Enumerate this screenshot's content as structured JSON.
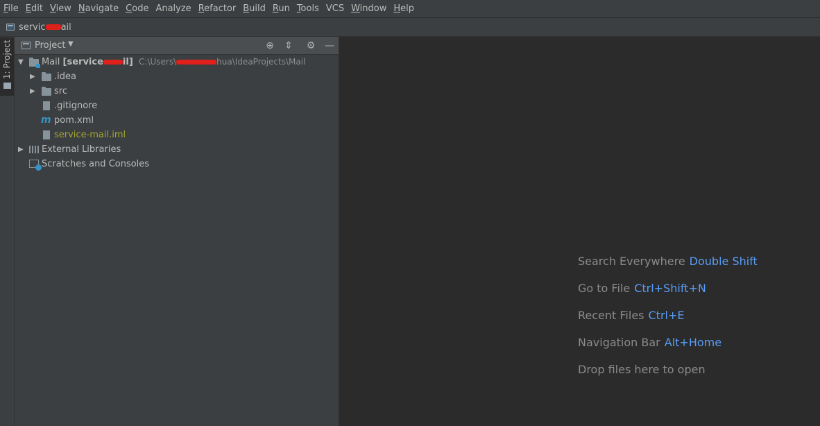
{
  "menu": {
    "items": [
      {
        "mnemonic": "F",
        "rest": "ile"
      },
      {
        "mnemonic": "E",
        "rest": "dit"
      },
      {
        "mnemonic": "V",
        "rest": "iew"
      },
      {
        "mnemonic": "N",
        "rest": "avigate"
      },
      {
        "mnemonic": "C",
        "rest": "ode"
      },
      {
        "mnemonic": "",
        "rest": "Analyze"
      },
      {
        "mnemonic": "R",
        "rest": "efactor"
      },
      {
        "mnemonic": "B",
        "rest": "uild"
      },
      {
        "mnemonic": "R",
        "rest": "un"
      },
      {
        "mnemonic": "T",
        "rest": "ools"
      },
      {
        "mnemonic": "",
        "rest": "VCS"
      },
      {
        "mnemonic": "W",
        "rest": "indow"
      },
      {
        "mnemonic": "H",
        "rest": "elp"
      }
    ]
  },
  "navbar": {
    "module_prefix": "servic",
    "module_suffix": "ail",
    "module_icon": "module-icon"
  },
  "side_strip": {
    "tab_label": "1: Project",
    "tab_icon": "folder-icon"
  },
  "project_panel": {
    "title": "Project",
    "dropdown_icon": "chevron-down-icon",
    "header_icons": [
      "locate-icon",
      "collapse-all-icon",
      "gear-icon",
      "minimize-icon"
    ],
    "tree": {
      "root": {
        "name": "Mail",
        "module_prefix": "[service",
        "module_suffix": "il]",
        "path_prefix": "C:\\Users\\",
        "path_suffix": "hua\\IdeaProjects\\Mail"
      },
      "children": [
        {
          "name": ".idea",
          "kind": "folder",
          "expandable": true
        },
        {
          "name": "src",
          "kind": "folder",
          "expandable": true
        },
        {
          "name": ".gitignore",
          "kind": "file",
          "expandable": false
        },
        {
          "name": "pom.xml",
          "kind": "maven",
          "expandable": false
        },
        {
          "name": "service-mail.iml",
          "kind": "iml",
          "expandable": false
        }
      ],
      "external_libraries": "External Libraries",
      "scratches": "Scratches and Consoles"
    }
  },
  "editor_hints": [
    {
      "label": "Search Everywhere",
      "shortcut": "Double Shift"
    },
    {
      "label": "Go to File",
      "shortcut": "Ctrl+Shift+N"
    },
    {
      "label": "Recent Files",
      "shortcut": "Ctrl+E"
    },
    {
      "label": "Navigation Bar",
      "shortcut": "Alt+Home"
    },
    {
      "label": "Drop files here to open",
      "shortcut": ""
    }
  ],
  "colors": {
    "background": "#2b2b2b",
    "panel": "#3c3f41",
    "accent_shortcut": "#589df6",
    "iml_file": "#a5a52e",
    "redaction": "#e0201a"
  }
}
